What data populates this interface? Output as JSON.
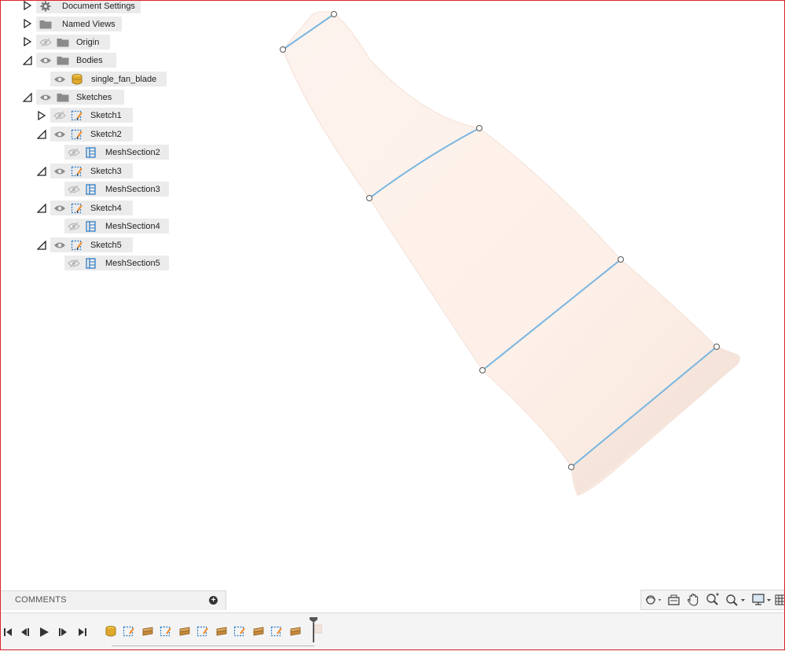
{
  "browser": {
    "items": [
      {
        "label": "Document Settings",
        "icon": "gear-icon",
        "expander": "collapsed"
      },
      {
        "label": "Named Views",
        "icon": "folder-icon",
        "expander": "collapsed"
      },
      {
        "label": "Origin",
        "icon": "folder-icon",
        "expander": "collapsed",
        "visibility": "hidden"
      },
      {
        "label": "Bodies",
        "icon": "folder-icon",
        "expander": "expanded",
        "visibility": "visible"
      },
      {
        "label": "single_fan_blade",
        "icon": "body-icon",
        "visibility": "visible"
      },
      {
        "label": "Sketches",
        "icon": "folder-icon",
        "expander": "expanded",
        "visibility": "visible"
      },
      {
        "label": "Sketch1",
        "icon": "sketch-icon",
        "expander": "collapsed",
        "visibility": "hidden"
      },
      {
        "label": "Sketch2",
        "icon": "sketch-icon",
        "expander": "expanded",
        "visibility": "visible"
      },
      {
        "label": "MeshSection2",
        "icon": "mesh-section-icon",
        "visibility": "hidden"
      },
      {
        "label": "Sketch3",
        "icon": "sketch-icon",
        "expander": "expanded",
        "visibility": "visible"
      },
      {
        "label": "MeshSection3",
        "icon": "mesh-section-icon",
        "visibility": "hidden"
      },
      {
        "label": "Sketch4",
        "icon": "sketch-icon",
        "expander": "expanded",
        "visibility": "visible"
      },
      {
        "label": "MeshSection4",
        "icon": "mesh-section-icon",
        "visibility": "hidden"
      },
      {
        "label": "Sketch5",
        "icon": "sketch-icon",
        "expander": "expanded",
        "visibility": "visible"
      },
      {
        "label": "MeshSection5",
        "icon": "mesh-section-icon",
        "visibility": "hidden"
      }
    ]
  },
  "comments": {
    "label": "COMMENTS",
    "add_icon": "plus-circle-icon"
  },
  "nav_toolbar": {
    "icons": [
      "orbit-icon",
      "look-at-icon",
      "pan-icon",
      "zoom-icon",
      "fit-icon",
      "display-settings-icon",
      "grid-icon"
    ]
  },
  "timeline": {
    "controls": [
      "skip-to-start-icon",
      "step-back-icon",
      "play-icon",
      "step-forward-icon",
      "skip-to-end-icon"
    ],
    "features": [
      "body-icon",
      "sketch-icon",
      "mesh-section-icon",
      "sketch-icon",
      "mesh-section-icon",
      "sketch-icon",
      "mesh-section-icon",
      "sketch-icon",
      "mesh-section-icon",
      "sketch-icon",
      "mesh-section-icon",
      "marker-icon"
    ]
  },
  "colors": {
    "blade_fill": "#fdf1ea",
    "section_line": "#79b6e0",
    "frame_border": "#d9232a",
    "sketch_blue": "#2f7ec6",
    "sketch_orange": "#f08a2a"
  }
}
